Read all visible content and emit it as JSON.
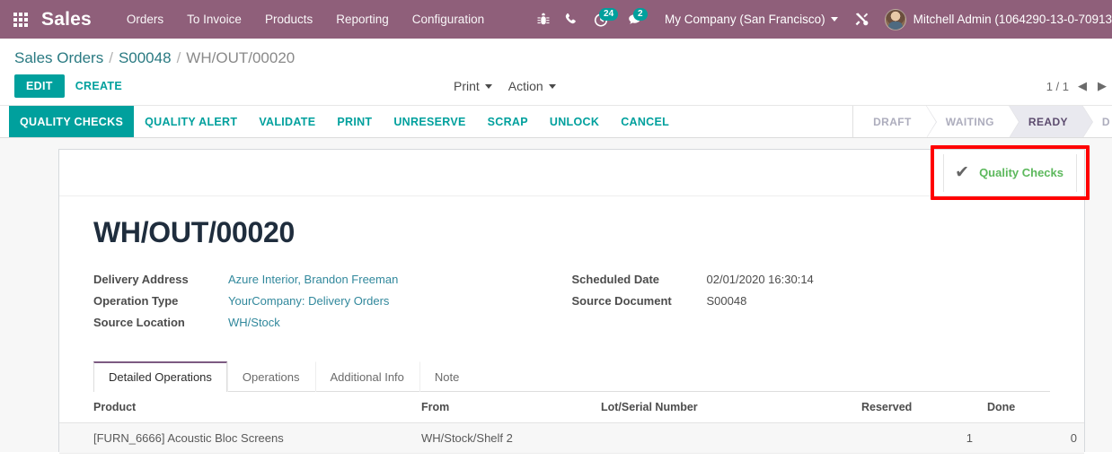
{
  "navbar": {
    "apps_icon": "apps-grid-icon",
    "brand": "Sales",
    "menu_items": [
      {
        "label": "Orders"
      },
      {
        "label": "To Invoice"
      },
      {
        "label": "Products"
      },
      {
        "label": "Reporting"
      },
      {
        "label": "Configuration"
      }
    ],
    "systray": {
      "bug_icon": "bug-icon",
      "phone_icon": "phone-icon",
      "activity_icon": "activity-clock-icon",
      "activity_count": "24",
      "messages_icon": "chat-bubble-icon",
      "messages_count": "2",
      "company": "My Company (San Francisco)",
      "tools_icon": "wrench-screwdriver-icon",
      "user_name": "Mitchell Admin (1064290-13-0-70913"
    }
  },
  "breadcrumb": {
    "root": "Sales Orders",
    "sep": "/",
    "parent": "S00048",
    "current": "WH/OUT/00020"
  },
  "control_panel": {
    "edit_label": "EDIT",
    "create_label": "CREATE",
    "print_label": "Print",
    "action_label": "Action",
    "pager": "1 / 1",
    "pager_prev_icon": "chevron-left-icon",
    "pager_next_icon": "chevron-right-icon"
  },
  "statusbar": {
    "buttons": [
      {
        "label": "QUALITY CHECKS",
        "primary": true
      },
      {
        "label": "QUALITY ALERT",
        "primary": false
      },
      {
        "label": "VALIDATE",
        "primary": false
      },
      {
        "label": "PRINT",
        "primary": false
      },
      {
        "label": "UNRESERVE",
        "primary": false
      },
      {
        "label": "SCRAP",
        "primary": false
      },
      {
        "label": "UNLOCK",
        "primary": false
      },
      {
        "label": "CANCEL",
        "primary": false
      }
    ],
    "states": [
      {
        "label": "DRAFT",
        "active": false
      },
      {
        "label": "WAITING",
        "active": false
      },
      {
        "label": "READY",
        "active": true
      },
      {
        "label": "D",
        "active": false
      }
    ]
  },
  "stat_button": {
    "icon": "check-mark-icon",
    "label": "Quality Checks",
    "annotation_color": "#ff0000",
    "label_color": "#5cb85c"
  },
  "form": {
    "title": "WH/OUT/00020",
    "left_fields": [
      {
        "label": "Delivery Address",
        "value": "Azure Interior, Brandon Freeman",
        "is_link": true
      },
      {
        "label": "Operation Type",
        "value": "YourCompany: Delivery Orders",
        "is_link": true
      },
      {
        "label": "Source Location",
        "value": "WH/Stock",
        "is_link": true
      }
    ],
    "right_fields": [
      {
        "label": "Scheduled Date",
        "value": "02/01/2020 16:30:14",
        "is_link": false
      },
      {
        "label": "Source Document",
        "value": "S00048",
        "is_link": false
      }
    ]
  },
  "notebook": {
    "tabs": [
      {
        "label": "Detailed Operations",
        "active": true
      },
      {
        "label": "Operations",
        "active": false
      },
      {
        "label": "Additional Info",
        "active": false
      },
      {
        "label": "Note",
        "active": false
      }
    ]
  },
  "lines": {
    "columns": [
      "Product",
      "From",
      "Lot/Serial Number",
      "Reserved",
      "Done"
    ],
    "rows": [
      {
        "product": "[FURN_6666] Acoustic Bloc Screens",
        "from": "WH/Stock/Shelf 2",
        "lot": "",
        "reserved": "1",
        "done": "0"
      }
    ]
  },
  "colors": {
    "navbar_bg": "#8f5f7a",
    "accent": "#00a09d",
    "link": "#31889c",
    "page_bg": "#f7f7f7"
  }
}
